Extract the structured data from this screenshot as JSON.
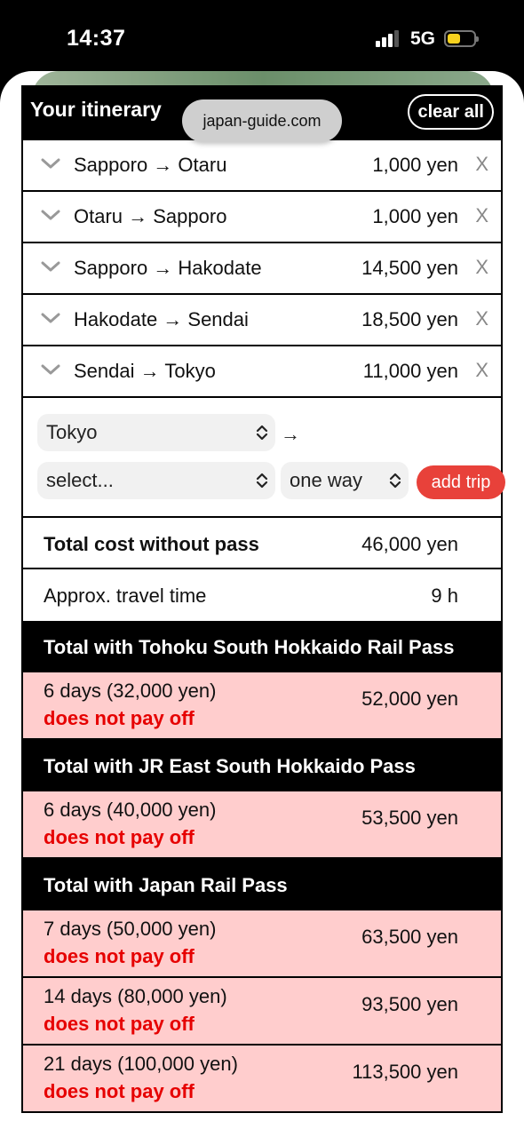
{
  "status_bar": {
    "time": "14:37",
    "network": "5G",
    "battery_level": 0.5,
    "signal_bars": 3
  },
  "browser": {
    "url": "japan-guide.com"
  },
  "itinerary": {
    "title": "Your itinerary",
    "clear_label": "clear all",
    "trips": [
      {
        "route": "Sapporo → Otaru",
        "cost": "1,000 yen",
        "remove": "X"
      },
      {
        "route": "Otaru → Sapporo",
        "cost": "1,000 yen",
        "remove": "X"
      },
      {
        "route": "Sapporo → Hakodate",
        "cost": "14,500 yen",
        "remove": "X"
      },
      {
        "route": "Hakodate → Sendai",
        "cost": "18,500 yen",
        "remove": "X"
      },
      {
        "route": "Sendai → Tokyo",
        "cost": "11,000 yen",
        "remove": "X"
      }
    ],
    "add_trip": {
      "from_value": "Tokyo",
      "arrow": "→",
      "to_value": "select...",
      "trip_type": "one way",
      "button_label": "add trip"
    },
    "summary": {
      "total_label": "Total cost without pass",
      "total_value": "46,000 yen",
      "time_label": "Approx. travel time",
      "time_value": "9 h"
    },
    "passes": [
      {
        "heading": "Total with Tohoku South Hokkaido Rail Pass",
        "options": [
          {
            "days": "6 days (32,000 yen)",
            "verdict": "does not pay off",
            "total": "52,000 yen"
          }
        ]
      },
      {
        "heading": "Total with JR East South Hokkaido Pass",
        "options": [
          {
            "days": "6 days (40,000 yen)",
            "verdict": "does not pay off",
            "total": "53,500 yen"
          }
        ]
      },
      {
        "heading": "Total with Japan Rail Pass",
        "options": [
          {
            "days": "7 days (50,000 yen)",
            "verdict": "does not pay off",
            "total": "63,500 yen"
          },
          {
            "days": "14 days (80,000 yen)",
            "verdict": "does not pay off",
            "total": "93,500 yen"
          },
          {
            "days": "21 days (100,000 yen)",
            "verdict": "does not pay off",
            "total": "113,500 yen"
          }
        ]
      }
    ]
  },
  "colors": {
    "accent_red": "#e8413a",
    "warning_text": "#e60000",
    "pass_row_bg": "#ffcdcd"
  }
}
